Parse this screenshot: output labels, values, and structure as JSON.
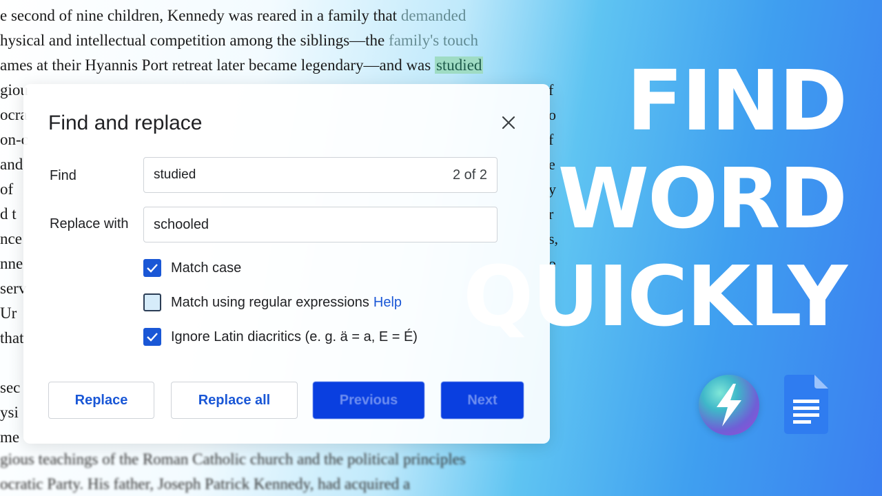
{
  "document": {
    "lines": [
      {
        "pre": "e second of nine children, Kennedy was reared in a family that ",
        "fade": "demanded",
        "hl": ""
      },
      {
        "pre": "hysical and intellectual competition among the siblings—the ",
        "fade": "family's touch",
        "hl": ""
      },
      {
        "pre": "ames at their Hyannis Port retreat later became legendary—and was ",
        "fade": "",
        "hl": "studied"
      }
    ],
    "left_fragments": [
      "giou",
      "ocra",
      "on-c",
      "and",
      "of",
      "d  t",
      "nce",
      "nne",
      "serv",
      "Ur",
      "that",
      "",
      "sec",
      "ysi",
      "me"
    ],
    "right_fragments": [
      "f",
      "o",
      "f",
      "e",
      "y",
      "r",
      "s,",
      "o",
      "e",
      "t"
    ],
    "bottom_lines": [
      "gious teachings of the Roman Catholic church and the political principles",
      "ocratic Party. His father, Joseph Patrick Kennedy, had acquired a"
    ]
  },
  "dialog": {
    "title": "Find and replace",
    "close_icon": "close-icon",
    "find_label": "Find",
    "find_value": "studied",
    "match_count": "2 of 2",
    "replace_label": "Replace with",
    "replace_value": "schooled",
    "options": [
      {
        "label": "Match case",
        "checked": true,
        "link": ""
      },
      {
        "label": "Match using regular expressions",
        "checked": false,
        "link": "Help"
      },
      {
        "label": "Ignore Latin diacritics (e. g. ä = a, E = É)",
        "checked": true,
        "link": ""
      }
    ],
    "buttons": {
      "replace": "Replace",
      "replace_all": "Replace all",
      "previous": "Previous",
      "next": "Next"
    }
  },
  "headline": {
    "line1": "FIND",
    "line2": "WORD",
    "line3": "QUICKLY"
  },
  "logos": {
    "bolt": "lightning-bolt-icon",
    "docs": "google-docs-icon"
  },
  "colors": {
    "accent": "#1a57d6",
    "primary_button": "#0a3fe0",
    "highlight": "#9fdcc4"
  }
}
